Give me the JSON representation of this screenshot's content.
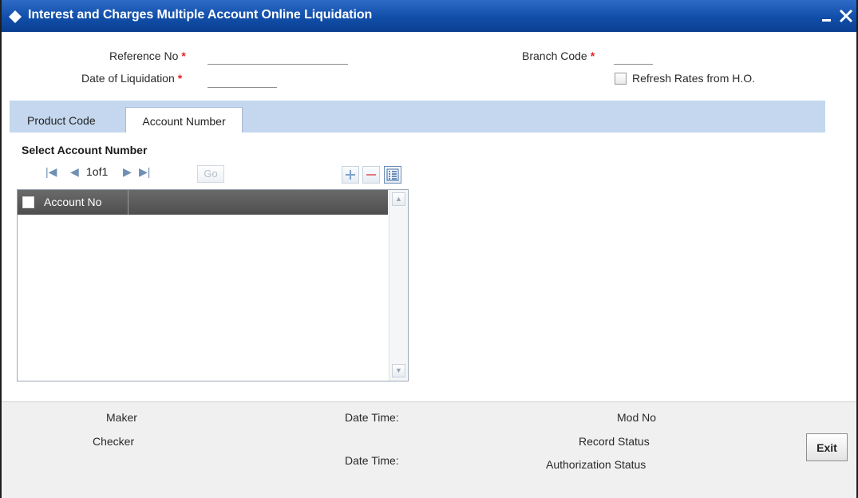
{
  "window": {
    "title": "Interest and Charges Multiple Account Online Liquidation",
    "minimize_icon": "minimize-icon",
    "close_icon": "close-icon"
  },
  "header": {
    "reference_no_label": "Reference No",
    "date_of_liquidation_label": "Date of Liquidation",
    "branch_code_label": "Branch Code",
    "required_mark": "*",
    "refresh_rates_label": "Refresh Rates from H.O.",
    "reference_no_value": "",
    "date_of_liquidation_value": "",
    "branch_code_value": ""
  },
  "tabs": [
    {
      "label": "Product Code",
      "active": false
    },
    {
      "label": "Account Number",
      "active": true
    }
  ],
  "section": {
    "title": "Select Account Number"
  },
  "grid": {
    "pagination": "1of1",
    "go_label": "Go",
    "columns": [
      "Account No"
    ],
    "rows": []
  },
  "footer": {
    "maker_label": "Maker",
    "checker_label": "Checker",
    "date_time_label_1": "Date Time:",
    "date_time_label_2": "Date Time:",
    "mod_no_label": "Mod No",
    "record_status_label": "Record Status",
    "authorization_status_label": "Authorization Status",
    "exit_label": "Exit"
  },
  "colors": {
    "titlebar": "#114ea9",
    "tabstrip": "#c4d7ee",
    "required": "#e52121",
    "grid_header": "#5a5a5a"
  }
}
